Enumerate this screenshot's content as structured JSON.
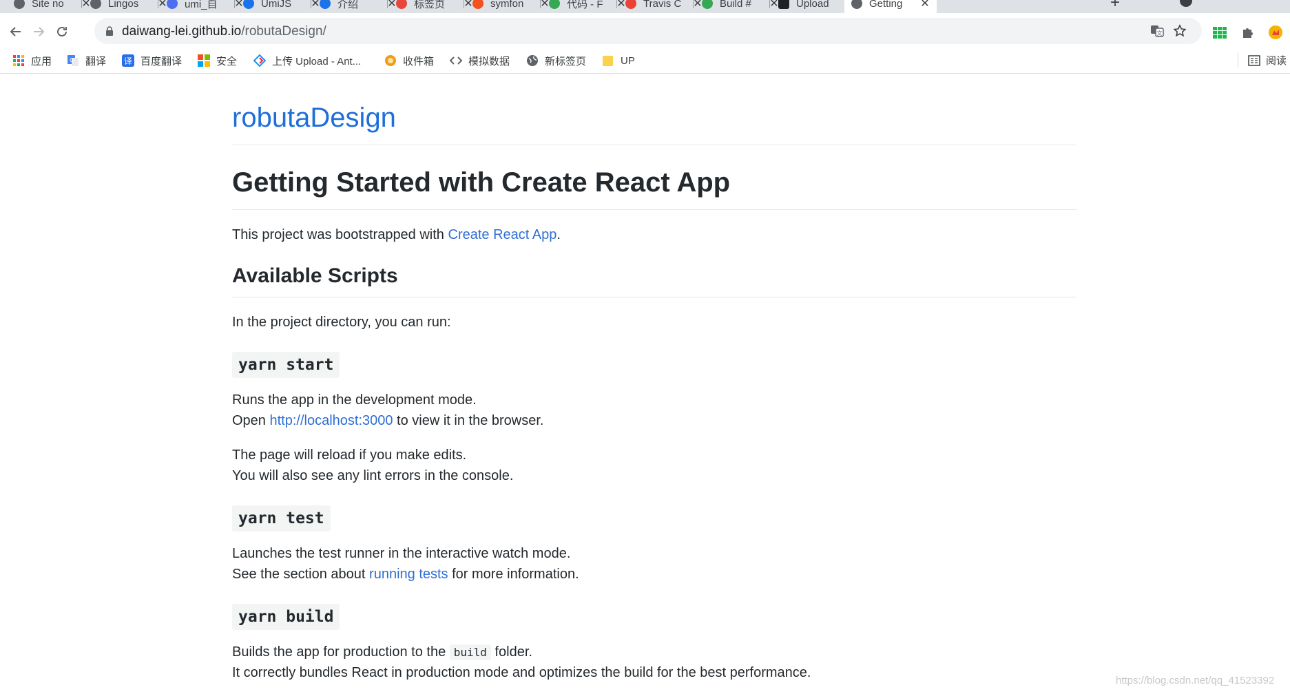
{
  "tabs": [
    {
      "title": "Site no",
      "favicon_color": "#5f6368"
    },
    {
      "title": "Lingos",
      "favicon_color": "#5f6368"
    },
    {
      "title": "umi_自",
      "favicon_color": "#4e6ef2"
    },
    {
      "title": "UmiJS",
      "favicon_color": "#1a73e8"
    },
    {
      "title": "介绍",
      "favicon_color": "#1a73e8"
    },
    {
      "title": "标签页",
      "favicon_color": "#e8453c"
    },
    {
      "title": "symfon",
      "favicon_color": "#f4511e"
    },
    {
      "title": "代码 - F",
      "favicon_color": "#34a853"
    },
    {
      "title": "Travis C",
      "favicon_color": "#ea4335"
    },
    {
      "title": "Build #",
      "favicon_color": "#34a853"
    },
    {
      "title": "Upload",
      "favicon_color": "#202124"
    },
    {
      "title": "Getting",
      "favicon_color": "#5f6368",
      "active": true
    }
  ],
  "toolbar": {
    "url_host": "daiwang-lei.github.io",
    "url_path": "/robutaDesign/"
  },
  "bookmarks": [
    {
      "label": "应用",
      "icon": "apps-grid-icon",
      "color": "#ea4335"
    },
    {
      "label": "翻译",
      "icon": "google-translate-icon",
      "color": "#4285f4"
    },
    {
      "label": "百度翻译",
      "icon": "baidu-translate-icon",
      "color": "#2a6de8"
    },
    {
      "label": "安全",
      "icon": "microsoft-icon",
      "color": "#f25022"
    },
    {
      "label": "上传 Upload - Ant...",
      "icon": "ant-design-icon",
      "color": "#1890ff"
    },
    {
      "label": "收件箱",
      "icon": "inbox-icon",
      "color": "#f39c12"
    },
    {
      "label": "模拟数据",
      "icon": "code-icon",
      "color": "#5f6368"
    },
    {
      "label": "新标签页",
      "icon": "globe-icon",
      "color": "#5f6368"
    },
    {
      "label": "UP",
      "icon": "folder-icon",
      "color": "#fbd24e"
    }
  ],
  "reading_list_label": "阅读",
  "page": {
    "site_title": "robutaDesign",
    "h1": "Getting Started with Create React App",
    "intro_prefix": "This project was bootstrapped with ",
    "intro_link": "Create React App",
    "intro_suffix": ".",
    "scripts_heading": "Available Scripts",
    "scripts_intro": "In the project directory, you can run:",
    "start_cmd": "yarn start",
    "start_line1": "Runs the app in the development mode.",
    "start_line2_prefix": "Open ",
    "start_line2_link": "http://localhost:3000",
    "start_line2_suffix": " to view it in the browser.",
    "start_line3": "The page will reload if you make edits.",
    "start_line4": "You will also see any lint errors in the console.",
    "test_cmd": "yarn test",
    "test_line1": "Launches the test runner in the interactive watch mode.",
    "test_line2_prefix": "See the section about ",
    "test_line2_link": "running tests",
    "test_line2_suffix": " for more information.",
    "build_cmd": "yarn build",
    "build_line1_prefix": "Builds the app for production to the ",
    "build_line1_code": "build",
    "build_line1_suffix": " folder.",
    "build_line2": "It correctly bundles React in production mode and optimizes the build for the best performance."
  },
  "watermark": "https://blog.csdn.net/qq_41523392"
}
